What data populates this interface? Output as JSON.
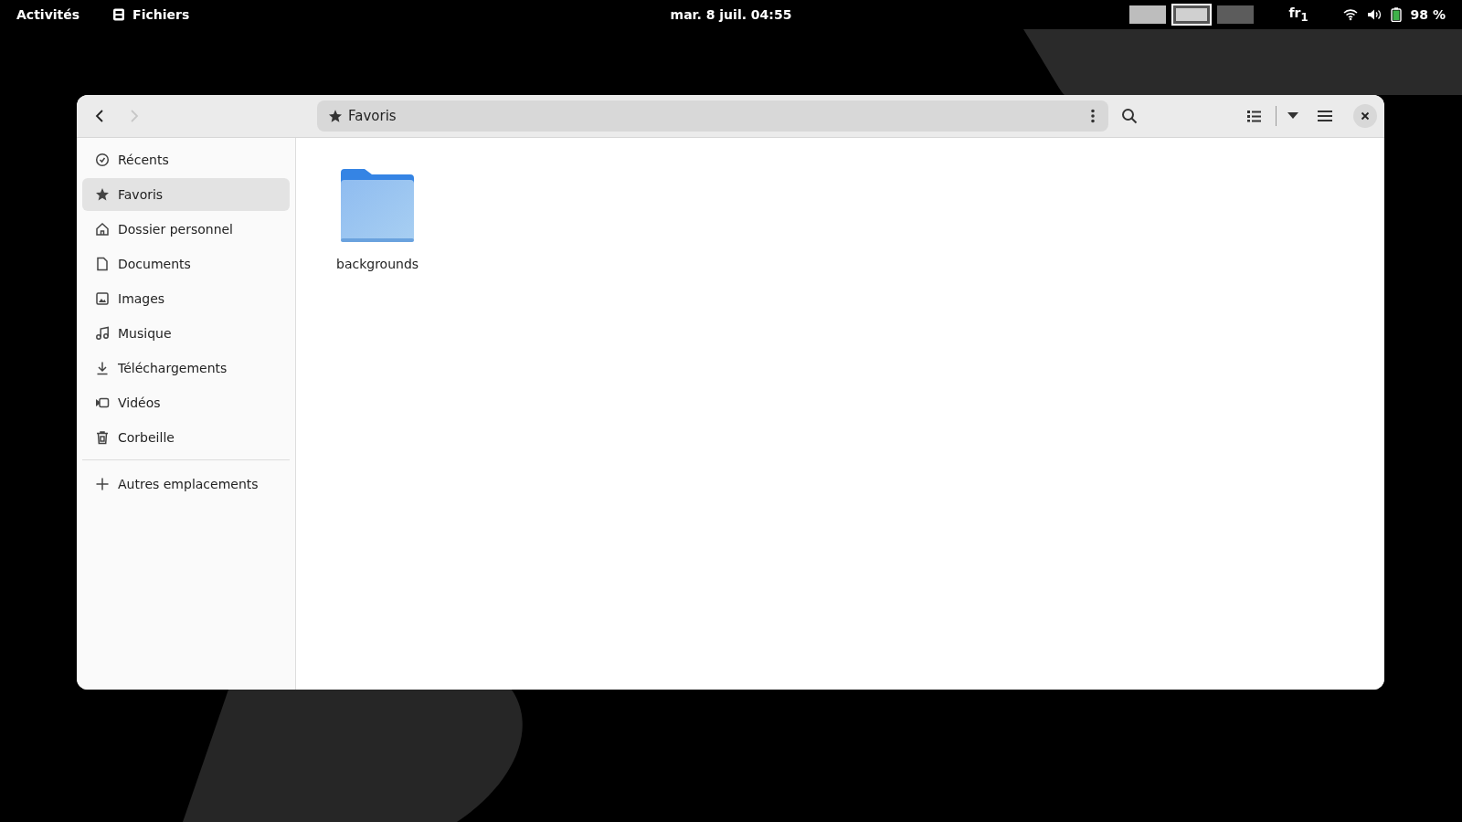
{
  "top_bar": {
    "activities": "Activités",
    "app_name": "Fichiers",
    "clock": "mar. 8 juil.  04:55",
    "workspaces": [
      {
        "selected": false
      },
      {
        "selected": true
      },
      {
        "selected": false
      }
    ],
    "keyboard_layout": "fr$_{1}$",
    "battery": "98 %"
  },
  "window": {
    "nav": [
      {
        "kind": "back",
        "disabled": false
      },
      {
        "kind": "forward",
        "disabled": true
      }
    ],
    "location": "Favoris",
    "sidebar": {
      "items": [
        {
          "label": "Récents",
          "selected": false
        },
        {
          "label": "Favoris",
          "selected": true
        },
        {
          "label": "Dossier personnel",
          "selected": false
        },
        {
          "label": "Documents",
          "selected": false
        },
        {
          "label": "Images",
          "selected": false
        },
        {
          "label": "Musique",
          "selected": false
        },
        {
          "label": "Téléchargements",
          "selected": false
        },
        {
          "label": "Vidéos",
          "selected": false
        },
        {
          "label": "Corbeille",
          "selected": false
        }
      ],
      "other": "Autres emplacements"
    },
    "files": [
      {
        "name": "backgrounds"
      }
    ]
  }
}
